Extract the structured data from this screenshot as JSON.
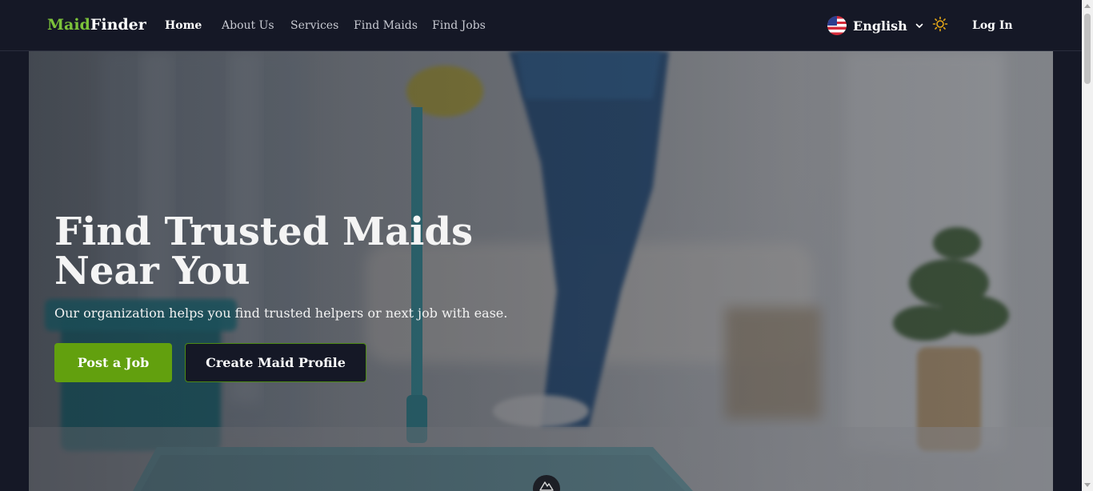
{
  "brand": {
    "part1": "Maid",
    "part2": "Finder",
    "accent_color": "#7cc23a"
  },
  "nav": {
    "links": [
      {
        "label": "Home",
        "active": true
      },
      {
        "label": "About Us",
        "active": false
      },
      {
        "label": "Services",
        "active": false
      },
      {
        "label": "Find Maids",
        "active": false
      },
      {
        "label": "Find Jobs",
        "active": false
      }
    ],
    "language": {
      "label": "English",
      "flag_icon": "us-flag-icon"
    },
    "theme_icon": "sun-icon",
    "login_label": "Log In"
  },
  "hero": {
    "title": "Find Trusted Maids Near You",
    "subtitle": "Our organization helps you find trusted helpers or next job with ease.",
    "primary_button": "Post a Job",
    "secondary_button": "Create Maid Profile",
    "background_image": "person mopping floor in bright living room",
    "primary_color": "#62a00e",
    "dark_color": "#151826"
  }
}
